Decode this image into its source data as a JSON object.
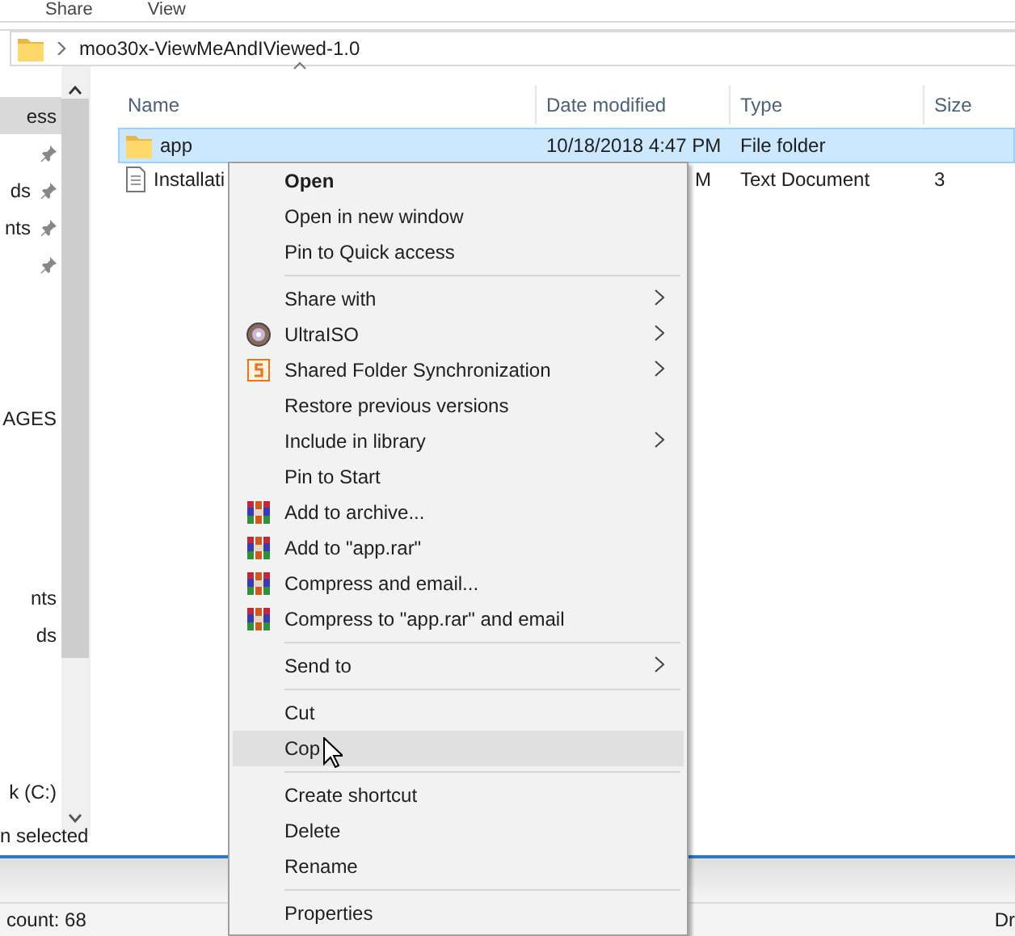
{
  "ribbon_tabs": [
    "Share",
    "View"
  ],
  "address_bar": {
    "path": "moo30x-ViewMeAndIViewed-1.0"
  },
  "navigation_pane": {
    "items": [
      {
        "label": "ess",
        "selected": true,
        "pinned": false
      },
      {
        "selected": false,
        "pinned": true
      },
      {
        "label": "ds",
        "selected": false,
        "pinned": true
      },
      {
        "label": "nts",
        "selected": false,
        "pinned": true
      },
      {
        "selected": false,
        "pinned": true
      },
      {
        "label": "AGES",
        "selected": false,
        "pinned": false
      },
      {
        "label": "nts",
        "selected": false,
        "pinned": false
      },
      {
        "label": "ds",
        "selected": false,
        "pinned": false
      },
      {
        "label": "k (C:)",
        "selected": false,
        "pinned": false
      }
    ]
  },
  "file_list": {
    "columns": [
      "Name",
      "Date modified",
      "Type",
      "Size"
    ],
    "rows": [
      {
        "kind": "folder",
        "selected": true,
        "cells": [
          "app",
          "10/18/2018 4:47 PM",
          "File folder",
          ""
        ]
      },
      {
        "kind": "document",
        "selected": false,
        "cells": [
          "Installati",
          "M",
          "Text Document",
          "3"
        ]
      }
    ]
  },
  "status_bar": {
    "text": "n selected"
  },
  "background_window": {
    "status_text": "count: 68",
    "column_2": "Dr"
  },
  "context_menu": {
    "items": [
      {
        "kind": "item",
        "label": "Open",
        "bold": true,
        "submenu": false,
        "highlighted": false
      },
      {
        "kind": "item",
        "label": "Open in new window",
        "bold": false,
        "submenu": false,
        "highlighted": false
      },
      {
        "kind": "item",
        "label": "Pin to Quick access",
        "bold": false,
        "submenu": false,
        "highlighted": false
      },
      {
        "kind": "separator"
      },
      {
        "kind": "item",
        "label": "Share with",
        "bold": false,
        "submenu": true,
        "highlighted": false
      },
      {
        "kind": "disc",
        "label": "UltraISO",
        "bold": false,
        "submenu": true,
        "highlighted": false
      },
      {
        "kind": "sync",
        "label": "Shared Folder Synchronization",
        "bold": false,
        "submenu": true,
        "highlighted": false
      },
      {
        "kind": "item",
        "label": "Restore previous versions",
        "bold": false,
        "submenu": false,
        "highlighted": false
      },
      {
        "kind": "item",
        "label": "Include in library",
        "bold": false,
        "submenu": true,
        "highlighted": false
      },
      {
        "kind": "item",
        "label": "Pin to Start",
        "bold": false,
        "submenu": false,
        "highlighted": false
      },
      {
        "kind": "archive",
        "label": "Add to archive...",
        "bold": false,
        "submenu": false,
        "highlighted": false
      },
      {
        "kind": "archive",
        "label": "Add to \"app.rar\"",
        "bold": false,
        "submenu": false,
        "highlighted": false
      },
      {
        "kind": "archive",
        "label": "Compress and email...",
        "bold": false,
        "submenu": false,
        "highlighted": false
      },
      {
        "kind": "archive",
        "label": "Compress to \"app.rar\" and email",
        "bold": false,
        "submenu": false,
        "highlighted": false
      },
      {
        "kind": "separator"
      },
      {
        "kind": "item",
        "label": "Send to",
        "bold": false,
        "submenu": true,
        "highlighted": false
      },
      {
        "kind": "separator"
      },
      {
        "kind": "item",
        "label": "Cut",
        "bold": false,
        "submenu": false,
        "highlighted": false
      },
      {
        "kind": "item",
        "label": "Cop",
        "bold": false,
        "submenu": false,
        "highlighted": true
      },
      {
        "kind": "separator"
      },
      {
        "kind": "item",
        "label": "Create shortcut",
        "bold": false,
        "submenu": false,
        "highlighted": false
      },
      {
        "kind": "item",
        "label": "Delete",
        "bold": false,
        "submenu": false,
        "highlighted": false
      },
      {
        "kind": "item",
        "label": "Rename",
        "bold": false,
        "submenu": false,
        "highlighted": false
      },
      {
        "kind": "separator"
      },
      {
        "kind": "item",
        "label": "Properties",
        "bold": false,
        "submenu": false,
        "highlighted": false
      }
    ]
  }
}
